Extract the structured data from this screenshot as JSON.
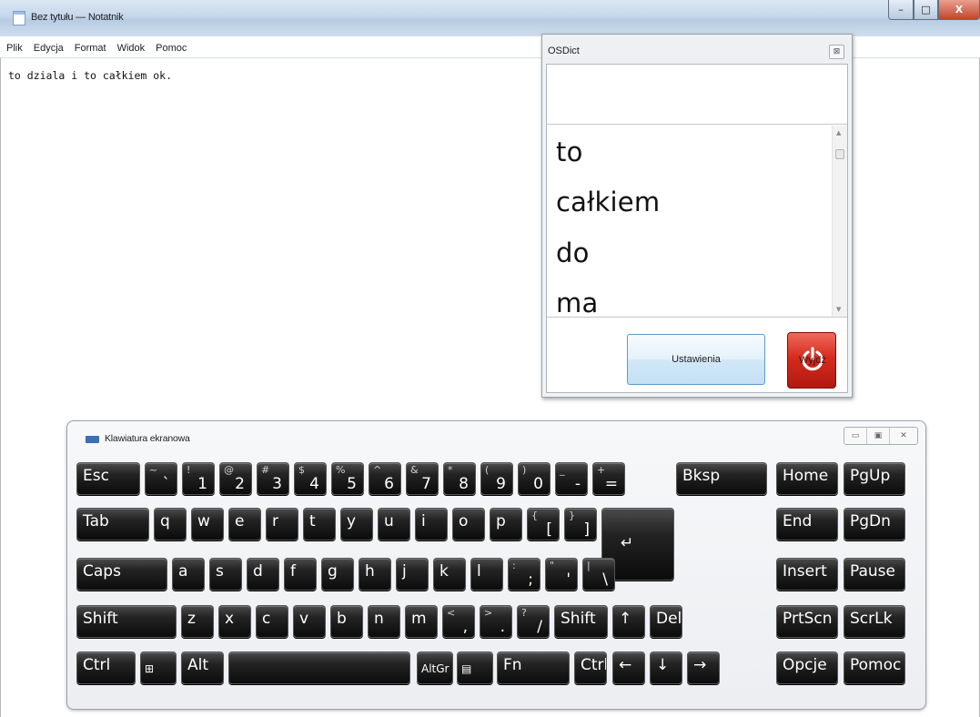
{
  "window": {
    "title": "Bez tytułu — Notatnik",
    "buttons": {
      "minimize": "–",
      "maximize": "□",
      "close": "X"
    }
  },
  "menu": [
    "Plik",
    "Edycja",
    "Format",
    "Widok",
    "Pomoc"
  ],
  "editor": {
    "text": "to dziala i to całkiem ok."
  },
  "osdict": {
    "title": "OSDict",
    "close_glyph": "⊠",
    "input_value": "",
    "words": [
      "to",
      "całkiem",
      "do",
      "ma"
    ],
    "settings_label": "Ustawienia",
    "exit_label": "Wyjdź"
  },
  "keyboard": {
    "title": "Klawiatura ekranowa",
    "rows": [
      [
        {
          "main": "Esc"
        },
        {
          "shift": "~",
          "main": "`"
        },
        {
          "shift": "!",
          "main": "1"
        },
        {
          "shift": "@",
          "main": "2"
        },
        {
          "shift": "#",
          "main": "3"
        },
        {
          "shift": "$",
          "main": "4"
        },
        {
          "shift": "%",
          "main": "5"
        },
        {
          "shift": "^",
          "main": "6"
        },
        {
          "shift": "&",
          "main": "7"
        },
        {
          "shift": "*",
          "main": "8"
        },
        {
          "shift": "(",
          "main": "9"
        },
        {
          "shift": ")",
          "main": "0"
        },
        {
          "shift": "_",
          "main": "-"
        },
        {
          "shift": "+",
          "main": "="
        },
        {
          "main": "Bksp"
        },
        {
          "main": "Home"
        },
        {
          "main": "PgUp"
        }
      ],
      [
        {
          "main": "Tab"
        },
        {
          "main": "q"
        },
        {
          "main": "w"
        },
        {
          "main": "e"
        },
        {
          "main": "r"
        },
        {
          "main": "t"
        },
        {
          "main": "y"
        },
        {
          "main": "u"
        },
        {
          "main": "i"
        },
        {
          "main": "o"
        },
        {
          "main": "p"
        },
        {
          "shift": "{",
          "main": "["
        },
        {
          "shift": "}",
          "main": "]"
        },
        {
          "main": "↵"
        },
        {
          "main": "End"
        },
        {
          "main": "PgDn"
        }
      ],
      [
        {
          "main": "Caps"
        },
        {
          "main": "a"
        },
        {
          "main": "s"
        },
        {
          "main": "d"
        },
        {
          "main": "f"
        },
        {
          "main": "g"
        },
        {
          "main": "h"
        },
        {
          "main": "j"
        },
        {
          "main": "k"
        },
        {
          "main": "l"
        },
        {
          "shift": ":",
          "main": ";"
        },
        {
          "shift": "\"",
          "main": "'"
        },
        {
          "shift": "|",
          "main": "\\"
        },
        {
          "main": "Insert"
        },
        {
          "main": "Pause"
        }
      ],
      [
        {
          "main": "Shift"
        },
        {
          "main": "z"
        },
        {
          "main": "x"
        },
        {
          "main": "c"
        },
        {
          "main": "v"
        },
        {
          "main": "b"
        },
        {
          "main": "n"
        },
        {
          "main": "m"
        },
        {
          "shift": "<",
          "main": ","
        },
        {
          "shift": ">",
          "main": "."
        },
        {
          "shift": "?",
          "main": "/"
        },
        {
          "main": "Shift"
        },
        {
          "main": "↑"
        },
        {
          "main": "Del"
        },
        {
          "main": "PrtScn"
        },
        {
          "main": "ScrLk"
        }
      ],
      [
        {
          "main": "Ctrl"
        },
        {
          "main": "⊞",
          "icon": "windows-logo-icon"
        },
        {
          "main": "Alt"
        },
        {
          "main": ""
        },
        {
          "main": "AltGr"
        },
        {
          "main": "▤",
          "icon": "menu-key-icon"
        },
        {
          "main": "Fn"
        },
        {
          "main": "Ctrl"
        },
        {
          "main": "←"
        },
        {
          "main": "↓"
        },
        {
          "main": "→"
        },
        {
          "main": "Opcje"
        },
        {
          "main": "Pomoc"
        }
      ]
    ]
  }
}
